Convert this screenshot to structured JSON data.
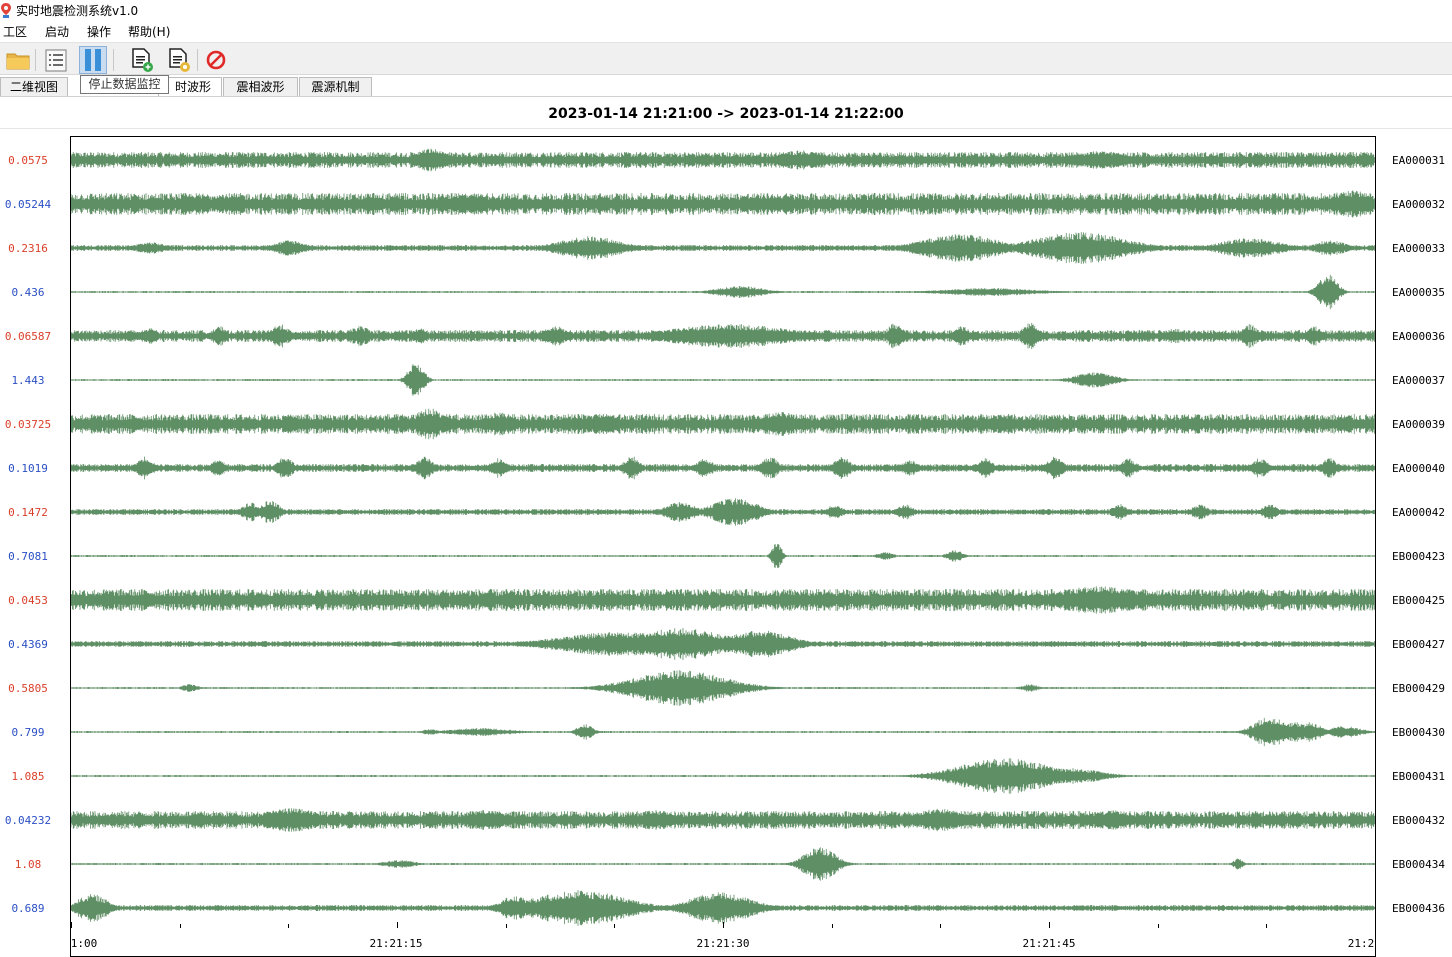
{
  "window": {
    "title": "实时地震检测系统v1.0"
  },
  "menu": [
    {
      "label": "工区"
    },
    {
      "label": "启动"
    },
    {
      "label": "操作"
    },
    {
      "label": "帮助(H)"
    }
  ],
  "toolbar": {
    "buttons": [
      {
        "name": "open-folder-button",
        "icon": "folder-icon"
      },
      {
        "name": "list-view-button",
        "icon": "list-icon"
      },
      {
        "name": "pause-button",
        "icon": "pause-icon"
      },
      {
        "name": "add-file-button",
        "icon": "file-add-icon"
      },
      {
        "name": "file-settings-button",
        "icon": "file-gear-icon"
      },
      {
        "name": "stop-button",
        "icon": "prohibited-icon"
      }
    ],
    "tooltip": "停止数据监控"
  },
  "tabs": [
    {
      "label": "二维视图",
      "active": false
    },
    {
      "label": "时波形",
      "active": true
    },
    {
      "label": "震相波形",
      "active": false
    },
    {
      "label": "震源机制",
      "active": false
    }
  ],
  "time_range": "2023-01-14 21:21:00  ->  2023-01-14 21:22:00",
  "plot": {
    "trace_color": "#5f8f65",
    "x_ticks": [
      "1:00",
      "21:21:15",
      "21:21:30",
      "21:21:45",
      "21:2"
    ],
    "traces": [
      {
        "station": "EA000031",
        "amp": "0.0575",
        "color": "#d9402b"
      },
      {
        "station": "EA000032",
        "amp": "0.05244",
        "color": "#2b4fc4"
      },
      {
        "station": "EA000033",
        "amp": "0.2316",
        "color": "#d9402b"
      },
      {
        "station": "EA000035",
        "amp": "0.436",
        "color": "#2b4fc4"
      },
      {
        "station": "EA000036",
        "amp": "0.06587",
        "color": "#d9402b"
      },
      {
        "station": "EA000037",
        "amp": "1.443",
        "color": "#2b4fc4"
      },
      {
        "station": "EA000039",
        "amp": "0.03725",
        "color": "#d9402b"
      },
      {
        "station": "EA000040",
        "amp": "0.1019",
        "color": "#2b4fc4"
      },
      {
        "station": "EA000042",
        "amp": "0.1472",
        "color": "#d9402b"
      },
      {
        "station": "EB000423",
        "amp": "0.7081",
        "color": "#2b4fc4"
      },
      {
        "station": "EB000425",
        "amp": "0.0453",
        "color": "#d9402b"
      },
      {
        "station": "EB000427",
        "amp": "0.4369",
        "color": "#2b4fc4"
      },
      {
        "station": "EB000429",
        "amp": "0.5805",
        "color": "#d9402b"
      },
      {
        "station": "EB000430",
        "amp": "0.799",
        "color": "#2b4fc4"
      },
      {
        "station": "EB000431",
        "amp": "1.085",
        "color": "#d9402b"
      },
      {
        "station": "EB000432",
        "amp": "0.04232",
        "color": "#2b4fc4"
      },
      {
        "station": "EB000434",
        "amp": "1.08",
        "color": "#d9402b"
      },
      {
        "station": "EB000436",
        "amp": "0.689",
        "color": "#2b4fc4"
      }
    ]
  }
}
